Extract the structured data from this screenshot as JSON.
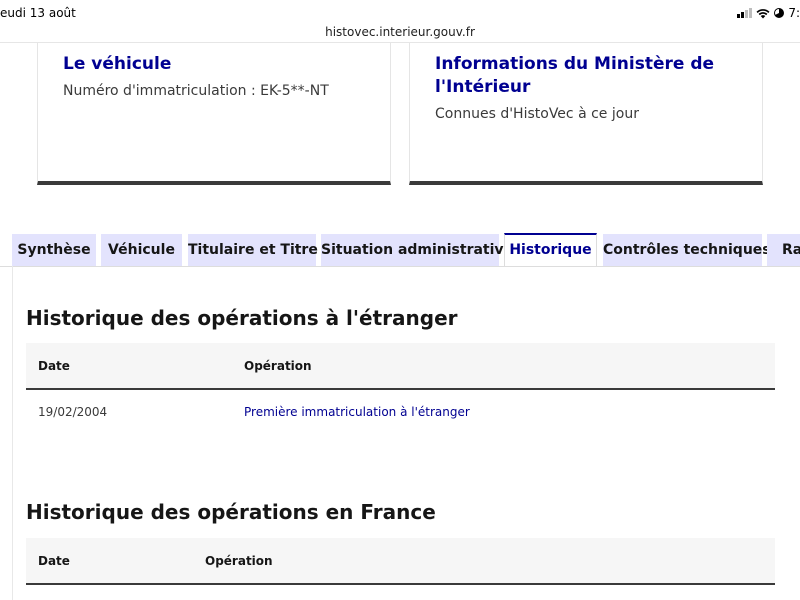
{
  "status_bar": {
    "date": "eudi 13 août",
    "time": "7:"
  },
  "browser": {
    "url": "histovec.interieur.gouv.fr"
  },
  "cards": {
    "vehicle": {
      "title": "Le véhicule",
      "text": "Numéro d'immatriculation : EK-5**-NT"
    },
    "ministere": {
      "title_line1": "Informations du Ministère de",
      "title_line2": "l'Intérieur",
      "text": "Connues d'HistoVec à ce jour"
    }
  },
  "tabs": [
    {
      "label": "Synthèse"
    },
    {
      "label": "Véhicule"
    },
    {
      "label": "Titulaire et Titre"
    },
    {
      "label": "Situation administrative"
    },
    {
      "label": "Historique"
    },
    {
      "label": "Contrôles techniques"
    },
    {
      "label": "Rap"
    }
  ],
  "active_tab": "Historique",
  "foreign_history": {
    "title": "Historique des opérations à l'étranger",
    "columns": [
      "Date",
      "Opération"
    ],
    "rows": [
      {
        "date": "19/02/2004",
        "operation": "Première immatriculation à l'étranger"
      }
    ]
  },
  "france_history": {
    "title": "Historique des opérations en France",
    "columns": [
      "Date",
      "Opération"
    ]
  },
  "colors": {
    "accent": "#000091",
    "tab_background": "#e3e3fd",
    "card_border": "#3a3a3a"
  }
}
